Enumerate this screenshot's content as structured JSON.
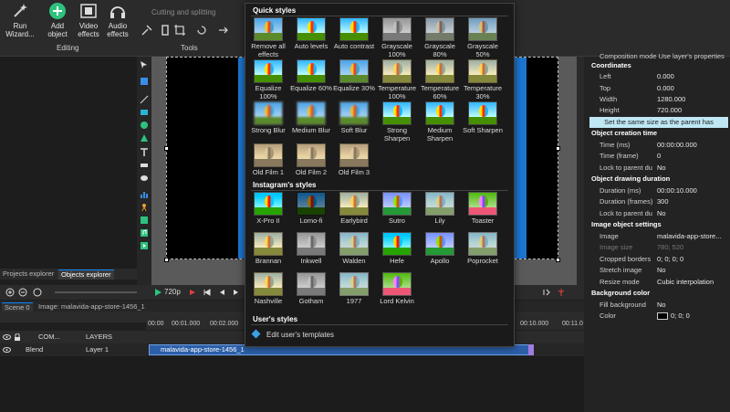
{
  "ribbon": {
    "buttons": [
      {
        "label": "Run Wizard...",
        "icon": "wand-icon"
      },
      {
        "label": "Add object",
        "icon": "plus-circle-icon"
      },
      {
        "label": "Video effects",
        "icon": "film-icon"
      },
      {
        "label": "Audio effects",
        "icon": "headphones-icon"
      }
    ],
    "editing_label": "Editing",
    "tools_label": "Tools",
    "cutting_label": "Cutting and splitting"
  },
  "left_tabs": [
    "Projects explorer",
    "Objects explorer"
  ],
  "playbar": {
    "resolution": "720p"
  },
  "scene_tabs": {
    "scene": "Scene 0",
    "image": "Image: malavida-app-store-1456_1"
  },
  "timeline": {
    "ruler": [
      "00:00",
      "00:01.000",
      "00:02.000",
      "00:10.000",
      "00:11.0"
    ],
    "layers_header": {
      "com": "COM...",
      "layers": "LAYERS"
    },
    "row": {
      "blend": "Blend",
      "layer": "Layer 1"
    },
    "clip_label": "malavida-app-store-1456_1"
  },
  "popup": {
    "quick_title": "Quick styles",
    "quick": [
      "Remove all effects",
      "Auto levels",
      "Auto contrast",
      "Grayscale 100%",
      "Grayscale 80%",
      "Grayscale 50%",
      "Equalize 100%",
      "Equalize 60%",
      "Equalize 30%",
      "Temperature 100%",
      "Temperature 60%",
      "Temperature 30%",
      "Strong Blur",
      "Medium Blur",
      "Soft Blur",
      "Strong Sharpen",
      "Medium Sharpen",
      "Soft Sharpen",
      "Old Film 1",
      "Old Film 2",
      "Old Film 3"
    ],
    "instagram_title": "Instagram's styles",
    "instagram": [
      "X-Pro II",
      "Lomo-fi",
      "Earlybird",
      "Sutro",
      "Lily",
      "Toaster",
      "Brannan",
      "Inkwell",
      "Walden",
      "Hefe",
      "Apollo",
      "Poprocket",
      "Nashville",
      "Gotham",
      "1977",
      "Lord Kelvin"
    ],
    "user_title": "User's styles",
    "edit_label": "Edit user's templates"
  },
  "props": {
    "header_partial": "Composition mode   Use layer's properties",
    "coordinates_title": "Coordinates",
    "coords": [
      {
        "k": "Left",
        "v": "0.000"
      },
      {
        "k": "Top",
        "v": "0.000"
      },
      {
        "k": "Width",
        "v": "1280.000"
      },
      {
        "k": "Height",
        "v": "720.000"
      }
    ],
    "note": "Set the same size as the parent has",
    "creation_title": "Object creation time",
    "creation": [
      {
        "k": "Time (ms)",
        "v": "00:00:00.000"
      },
      {
        "k": "Time (frame)",
        "v": "0"
      },
      {
        "k": "Lock to parent du",
        "v": "No"
      }
    ],
    "drawing_title": "Object drawing duration",
    "drawing": [
      {
        "k": "Duration (ms)",
        "v": "00:00:10.000"
      },
      {
        "k": "Duration (frames)",
        "v": "300"
      },
      {
        "k": "Lock to parent du",
        "v": "No"
      }
    ],
    "image_title": "Image object settings",
    "image": [
      {
        "k": "Image",
        "v": "malavida-app-store..."
      },
      {
        "k": "Image size",
        "v": "780; 520"
      },
      {
        "k": "Cropped borders",
        "v": "0; 0; 0; 0"
      },
      {
        "k": "Stretch image",
        "v": "No"
      },
      {
        "k": "Resize mode",
        "v": "Cubic interpolation"
      }
    ],
    "bg_title": "Background color",
    "bg": [
      {
        "k": "Fill background",
        "v": "No"
      },
      {
        "k": "Color",
        "v": "0; 0; 0"
      }
    ]
  }
}
